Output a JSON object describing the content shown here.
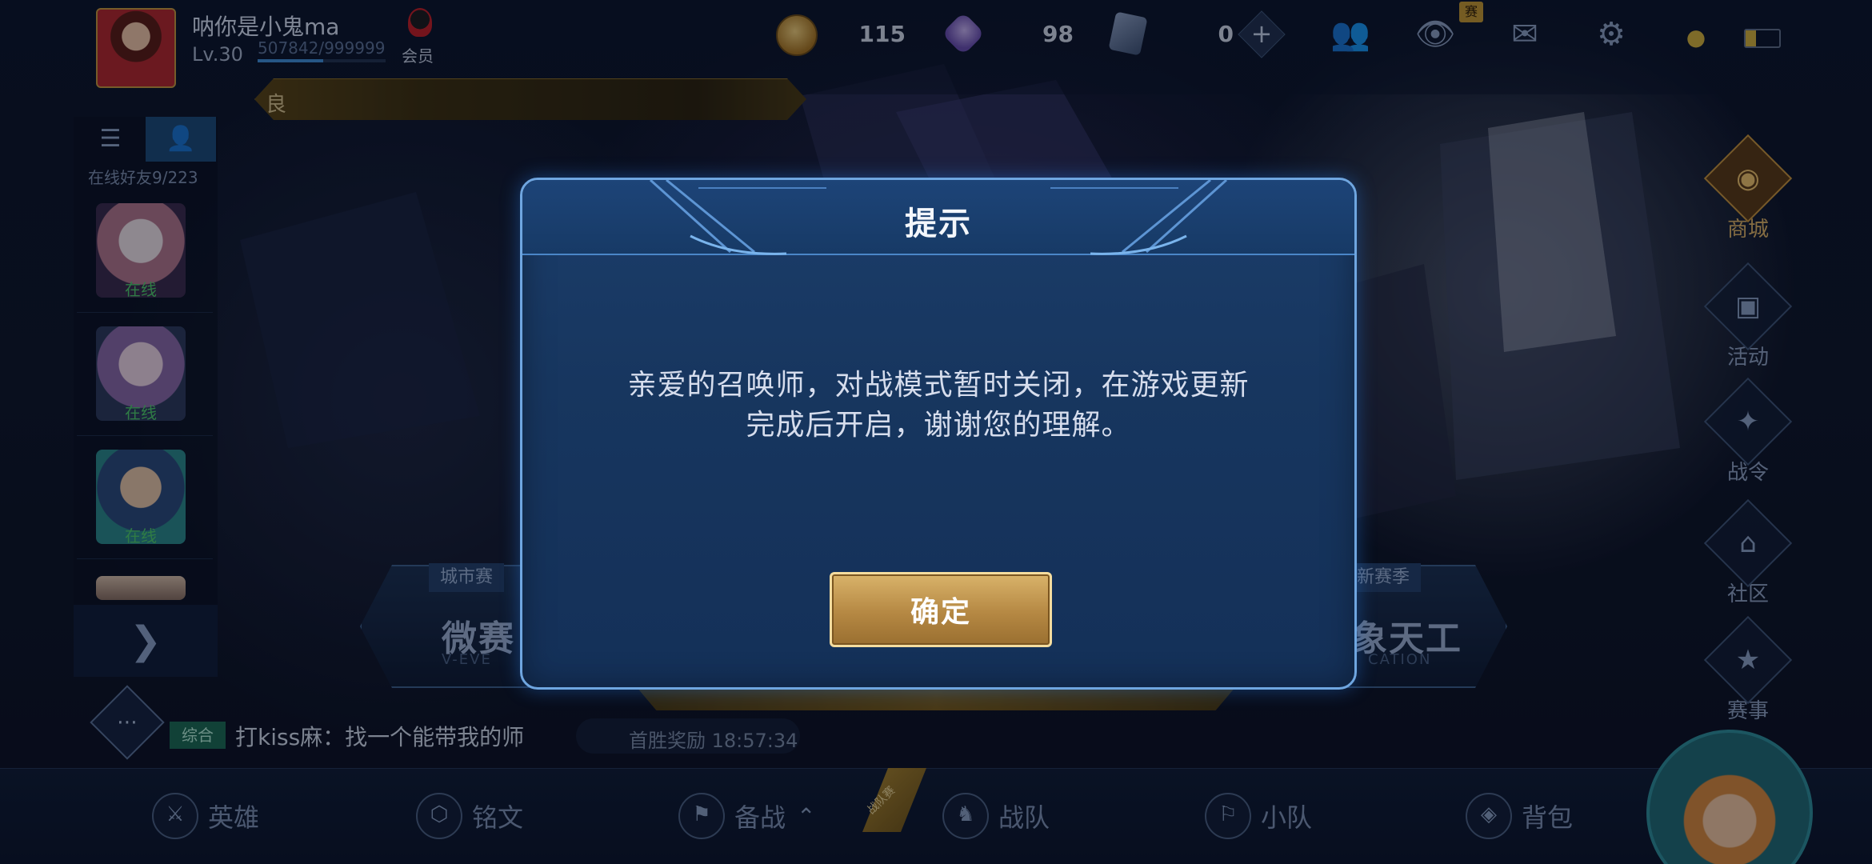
{
  "player": {
    "name": "呐你是小鬼ma",
    "level": "Lv.30",
    "exp": "507842/999999",
    "exp_fraction": 0.51,
    "vip_label": "会员"
  },
  "resources": {
    "coin": "115",
    "gem": "98",
    "card": "0"
  },
  "top_icons": {
    "friends": "friends-icon",
    "watch_badge": "赛",
    "battery_level": 0.3
  },
  "banner": {
    "text": "良"
  },
  "left_panel": {
    "friends_online": "在线好友9/223",
    "friend_statuses": [
      "在线",
      "在线",
      "在线"
    ]
  },
  "chat": {
    "tag": "综合",
    "message": "打kiss麻：找一个能带我的师",
    "first_win": "首胜奖励 18:57:34"
  },
  "mode_cards": {
    "left_tag": "城市赛",
    "left_title": "微赛",
    "left_sub": "V-EVE",
    "right_tag": "战新赛季",
    "right_title": "象天工",
    "right_sub": "CATION"
  },
  "right_menu": {
    "shop": "商城",
    "events": "活动",
    "battle_pass": "战令",
    "community": "社区",
    "tournament": "赛事"
  },
  "bottom_nav": {
    "heroes": "英雄",
    "runes": "铭文",
    "prepare": "备战",
    "team": "战队",
    "squad": "小队",
    "bag": "背包",
    "ribbon": "战队赛"
  },
  "modal": {
    "title": "提示",
    "message_line1": "亲爱的召唤师，对战模式暂时关闭，在游戏更新",
    "message_line2": "完成后开启，谢谢您的理解。",
    "confirm": "确定"
  },
  "colors": {
    "modal_border": "#6fa6e0",
    "modal_bg": "#17365f",
    "confirm_gold": "#b58843",
    "online_green": "#4fcf6a"
  }
}
